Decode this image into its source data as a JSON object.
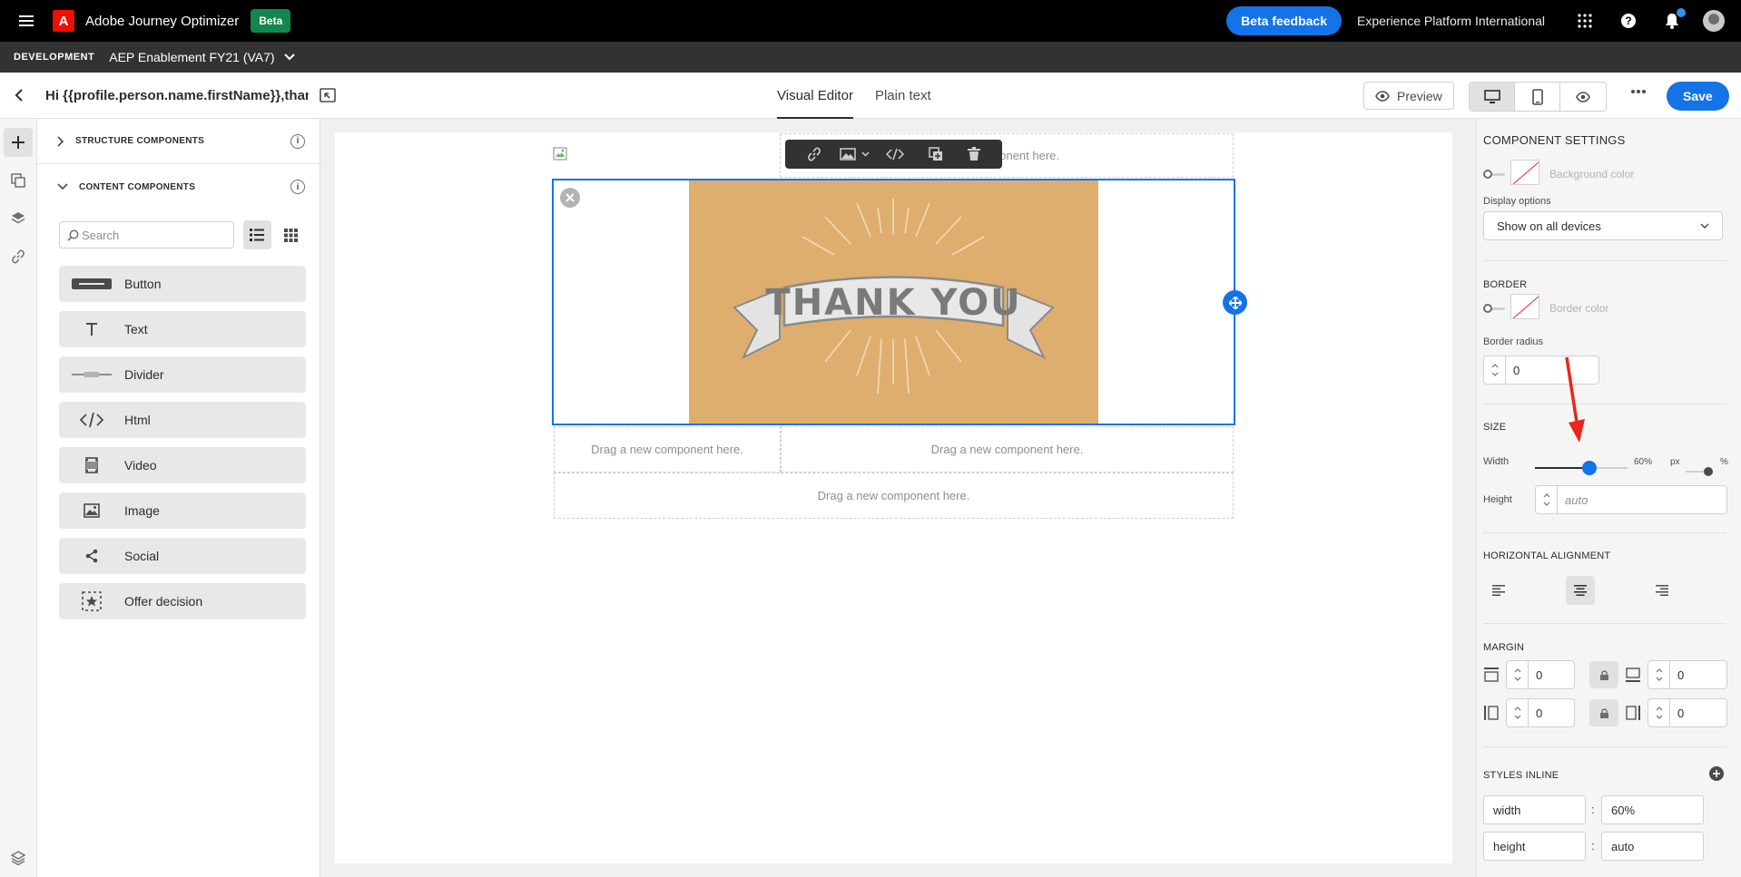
{
  "topbar": {
    "logo_letter": "A",
    "app_name": "Adobe Journey Optimizer",
    "beta_badge": "Beta",
    "feedback_label": "Beta feedback",
    "org_name": "Experience Platform International",
    "icons": [
      "menu-icon",
      "apps-grid-icon",
      "help-icon",
      "bell-icon",
      "avatar"
    ]
  },
  "subbar": {
    "label": "DEVELOPMENT",
    "sandbox": "AEP Enablement FY21 (VA7)"
  },
  "editor": {
    "subject": "Hi {{profile.person.name.firstName}},than...",
    "tabs": [
      {
        "label": "Visual Editor",
        "active": true
      },
      {
        "label": "Plain text",
        "active": false
      }
    ],
    "preview_label": "Preview",
    "save_label": "Save"
  },
  "components_panel": {
    "structure_title": "STRUCTURE COMPONENTS",
    "content_title": "CONTENT COMPONENTS",
    "search_placeholder": "Search",
    "items": [
      {
        "label": "Button",
        "icon": "button-icon"
      },
      {
        "label": "Text",
        "icon": "text-icon"
      },
      {
        "label": "Divider",
        "icon": "divider-icon"
      },
      {
        "label": "Html",
        "icon": "code-icon"
      },
      {
        "label": "Video",
        "icon": "video-icon"
      },
      {
        "label": "Image",
        "icon": "image-icon"
      },
      {
        "label": "Social",
        "icon": "share-icon"
      },
      {
        "label": "Offer decision",
        "icon": "offer-decision-icon"
      }
    ]
  },
  "canvas": {
    "drop_text": "Drag a new component here.",
    "partial_drop_text": "ponent here.",
    "image_text": "THANK YOU",
    "colors": {
      "image_bg": "#deae6e",
      "selection": "#1473e6"
    }
  },
  "settings": {
    "title": "COMPONENT SETTINGS",
    "background_color_label": "Background color",
    "display_options_label": "Display options",
    "display_options_value": "Show on all devices",
    "border_title": "BORDER",
    "border_color_label": "Border color",
    "border_radius_label": "Border radius",
    "border_radius_value": "0",
    "size_title": "SIZE",
    "width_label": "Width",
    "width_value": "60%",
    "width_fraction": 0.6,
    "unit_px": "px",
    "unit_pct": "%",
    "height_label": "Height",
    "height_placeholder": "auto",
    "halign_title": "HORIZONTAL ALIGNMENT",
    "halign_selected": "center",
    "margin_title": "MARGIN",
    "margin_top": "0",
    "margin_bottom": "0",
    "margin_left": "0",
    "margin_right": "0",
    "styles_inline_title": "STYLES INLINE",
    "styles": [
      {
        "prop": "width",
        "value": "60%"
      },
      {
        "prop": "height",
        "value": "auto"
      }
    ],
    "separator": ":"
  }
}
